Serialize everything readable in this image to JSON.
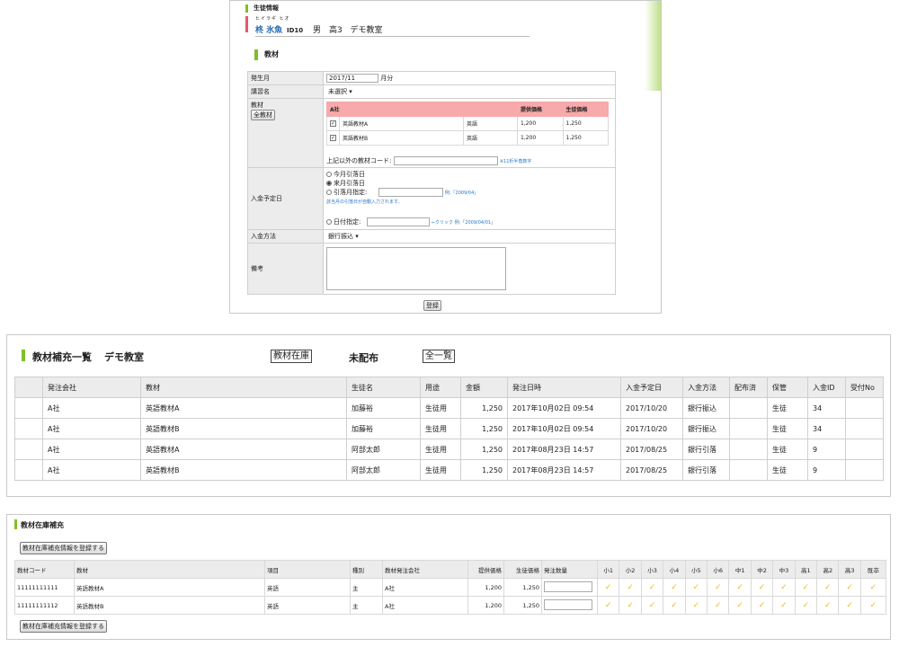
{
  "student": {
    "section_title": "生徒情報",
    "kana": "ヒイラギ ヒオ",
    "name": "柊 氷魚",
    "id": "ID10",
    "gender": "男",
    "grade": "高3",
    "school": "デモ教室"
  },
  "material_form": {
    "section_title": "教材",
    "labels": {
      "month": "発生月",
      "course": "講習名",
      "material": "教材",
      "deposit_date": "入金予定日",
      "payment_method": "入金方法",
      "remarks": "備考"
    },
    "month_value": "2017/11",
    "month_suffix": "月分",
    "course_value": "未選択",
    "all_materials_button": "全教材",
    "company": "A社",
    "price_header": "提供価格",
    "student_price_header": "生徒価格",
    "items": [
      {
        "name": "英語教材A",
        "subject": "英語",
        "price": "1,200",
        "student_price": "1,250",
        "checked": true
      },
      {
        "name": "英語教材B",
        "subject": "英語",
        "price": "1,200",
        "student_price": "1,250",
        "checked": true
      }
    ],
    "other_code_label": "上記以外の教材コード:",
    "other_code_hint": "※11桁半角数字",
    "deposit_options": {
      "this_month": "今月引落日",
      "next_month": "来月引落日",
      "month_spec": "引落月指定:",
      "month_spec_hint": "例:「2009/04」",
      "month_spec_note": "該当月の引落日が自動入力されます。",
      "date_spec": "日付指定:",
      "date_spec_hint": "←クリック 例:「2009/04/01」"
    },
    "payment_method_value": "銀行振込",
    "submit_button": "登録"
  },
  "replenish_list": {
    "title": "教材補充一覧",
    "school": "デモ教室",
    "stock_button": "教材在庫",
    "undistributed_label": "未配布",
    "all_list_button": "全一覧",
    "headers": [
      "",
      "発注会社",
      "教材",
      "生徒名",
      "用途",
      "金額",
      "発注日時",
      "入金予定日",
      "入金方法",
      "配布済",
      "保管",
      "入金ID",
      "受付No"
    ],
    "rows": [
      [
        "",
        "A社",
        "英語教材A",
        "加藤裕",
        "生徒用",
        "1,250",
        "2017年10月02日 09:54",
        "2017/10/20",
        "銀行振込",
        "",
        "生徒",
        "34",
        ""
      ],
      [
        "",
        "A社",
        "英語教材B",
        "加藤裕",
        "生徒用",
        "1,250",
        "2017年10月02日 09:54",
        "2017/10/20",
        "銀行振込",
        "",
        "生徒",
        "34",
        ""
      ],
      [
        "",
        "A社",
        "英語教材A",
        "阿部太郎",
        "生徒用",
        "1,250",
        "2017年08月23日 14:57",
        "2017/08/25",
        "銀行引落",
        "",
        "生徒",
        "9",
        ""
      ],
      [
        "",
        "A社",
        "英語教材B",
        "阿部太郎",
        "生徒用",
        "1,250",
        "2017年08月23日 14:57",
        "2017/08/25",
        "銀行引落",
        "",
        "生徒",
        "9",
        ""
      ]
    ]
  },
  "stock_replenish": {
    "title": "教材在庫補充",
    "register_button": "教材在庫補充情報を登録する",
    "headers": [
      "教材コード",
      "教材",
      "項目",
      "種別",
      "教材発注会社",
      "提供価格",
      "生徒価格",
      "発注数量",
      "小1",
      "小2",
      "小3",
      "小4",
      "小5",
      "小6",
      "中1",
      "中2",
      "中3",
      "高1",
      "高2",
      "高3",
      "既卒"
    ],
    "rows": [
      {
        "code": "11111111111",
        "name": "英語教材A",
        "item": "英語",
        "kind": "主",
        "company": "A社",
        "price": "1,200",
        "student_price": "1,250"
      },
      {
        "code": "11111111112",
        "name": "英語教材B",
        "item": "英語",
        "kind": "主",
        "company": "A社",
        "price": "1,200",
        "student_price": "1,250"
      }
    ],
    "check_mark": "✓"
  },
  "colors": {
    "accent_green": "#7fbf27",
    "pink_header": "#f7a9ac",
    "check_yellow": "#f2b90f",
    "link_blue": "#2a78c8"
  }
}
